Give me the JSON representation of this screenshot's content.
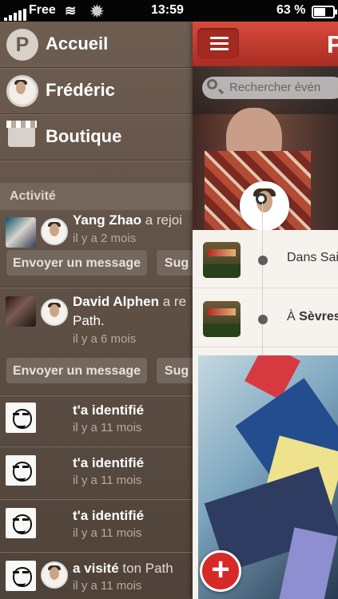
{
  "status_bar": {
    "carrier": "Free",
    "time": "13:59",
    "battery_percent": "63 %",
    "battery_level": 0.63
  },
  "menu": {
    "items": [
      {
        "label": "Accueil",
        "icon": "path-logo-icon"
      },
      {
        "label": "Frédéric",
        "icon": "profile-avatar"
      },
      {
        "label": "Boutique",
        "icon": "store-icon"
      }
    ],
    "section_title": "Activité"
  },
  "activity": [
    {
      "name": "Yang Zhao",
      "rest": "a rejoi",
      "time": "il y a 2 mois",
      "send_label": "Envoyer un message",
      "suggest_label": "Sug"
    },
    {
      "name": "David Alphen",
      "rest": "a re",
      "line2": "Path.",
      "time": "il y a 6 mois",
      "send_label": "Envoyer un message",
      "suggest_label": "Sug"
    },
    {
      "name": "t'a identifié",
      "time": "il y a 11 mois"
    },
    {
      "name": "t'a identifié",
      "time": "il y a 11 mois"
    },
    {
      "name": "t'a identifié",
      "time": "il y a 11 mois"
    },
    {
      "name": "a visité",
      "rest": "ton Path",
      "time": "il y a 11 mois"
    }
  ],
  "content": {
    "logo": "P",
    "search_placeholder": "Rechercher évén",
    "events": [
      {
        "prefix": "Dans Sai",
        "bold": ""
      },
      {
        "prefix": "À ",
        "bold": "Sèvres"
      }
    ],
    "plus_label": "+"
  },
  "colors": {
    "accent_red": "#d52a27",
    "menu_brown": "#5f5045"
  }
}
